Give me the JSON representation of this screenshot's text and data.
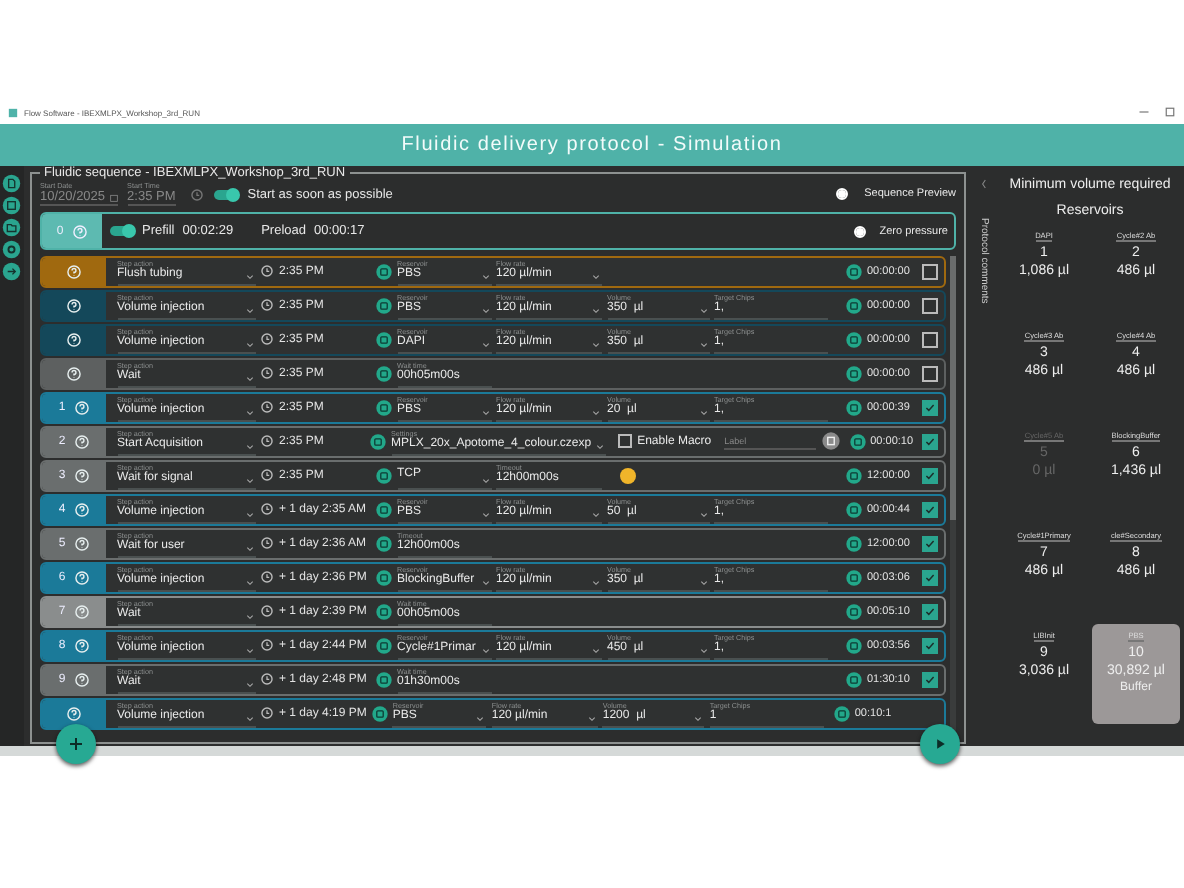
{
  "window": {
    "title": "Flow Software - IBEXMLPX_Workshop_3rd_RUN"
  },
  "header": {
    "title": "Fluidic delivery protocol - Simulation"
  },
  "sequence": {
    "title": "Fluidic sequence - IBEXMLPX_Workshop_3rd_RUN",
    "start_date": {
      "label": "Start Date",
      "value": "10/20/2025"
    },
    "start_time": {
      "label": "Start Time",
      "value": "2:35 PM"
    },
    "asap": {
      "label": "Start as soon as possible",
      "on": true
    },
    "preview": {
      "label": "Sequence Preview",
      "selected": true
    },
    "prefill": {
      "number": "0",
      "toggle_on": true,
      "prefill_label": "Prefill",
      "prefill_time": "00:02:29",
      "preload_label": "Preload",
      "preload_time": "00:00:17",
      "zero": {
        "label": "Zero pressure",
        "selected": true
      }
    },
    "steps": [
      {
        "color": "#a0690f",
        "action_label": "Step action",
        "action": "Flush tubing",
        "time": "2:35 PM",
        "fields": [
          {
            "label": "Reservoir",
            "value": "PBS",
            "dropdown": true
          },
          {
            "label": "Flow rate",
            "value": "120 µl/min",
            "dropdown": true
          }
        ],
        "duration": "00:00:00",
        "checked": false
      },
      {
        "color": "#14485a",
        "action_label": "Step action",
        "action": "Volume injection",
        "time": "2:35 PM",
        "fields": [
          {
            "label": "Reservoir",
            "value": "PBS",
            "dropdown": true
          },
          {
            "label": "Flow rate",
            "value": "120 µl/min",
            "dropdown": true
          },
          {
            "label": "Volume",
            "value": "350",
            "unit": "µl",
            "dropdown": true
          },
          {
            "label": "Target Chips",
            "value": "1,",
            "dropdown": false
          }
        ],
        "duration": "00:00:00",
        "checked": false
      },
      {
        "color": "#14485a",
        "action_label": "Step action",
        "action": "Volume injection",
        "time": "2:35 PM",
        "fields": [
          {
            "label": "Reservoir",
            "value": "DAPI",
            "dropdown": true
          },
          {
            "label": "Flow rate",
            "value": "120 µl/min",
            "dropdown": true
          },
          {
            "label": "Volume",
            "value": "350",
            "unit": "µl",
            "dropdown": true
          },
          {
            "label": "Target Chips",
            "value": "1,",
            "dropdown": false
          }
        ],
        "duration": "00:00:00",
        "checked": false
      },
      {
        "color": "#5d6060",
        "action_label": "Step action",
        "action": "Wait",
        "time": "2:35 PM",
        "fields": [
          {
            "label": "Wait time",
            "value": "00h05m00s",
            "dropdown": false
          }
        ],
        "duration": "00:00:00",
        "checked": false
      },
      {
        "number": "1",
        "color": "#1b7a99",
        "action_label": "Step action",
        "action": "Volume injection",
        "time": "2:35 PM",
        "fields": [
          {
            "label": "Reservoir",
            "value": "PBS",
            "dropdown": true
          },
          {
            "label": "Flow rate",
            "value": "120 µl/min",
            "dropdown": true
          },
          {
            "label": "Volume",
            "value": "20",
            "unit": "µl",
            "dropdown": true
          },
          {
            "label": "Target Chips",
            "value": "1,",
            "dropdown": false
          }
        ],
        "duration": "00:00:39",
        "checked": true
      },
      {
        "number": "2",
        "color": "#6a6e6e",
        "action_label": "Step action",
        "action": "Start Acquisition",
        "time": "2:35 PM",
        "fields": [
          {
            "label": "Settings",
            "value": "MPLX_20x_Apotome_4_colour.czexp",
            "dropdown": true
          }
        ],
        "macro": {
          "label": "Enable Macro",
          "checked": false
        },
        "label_field": {
          "placeholder": "Label"
        },
        "duration": "00:00:10",
        "checked": true
      },
      {
        "number": "3",
        "color": "#6a6e6e",
        "action_label": "Step action",
        "action": "Wait for signal",
        "time": "2:35 PM",
        "fields": [
          {
            "value": "TCP",
            "dropdown": true
          },
          {
            "label": "Timeout",
            "value": "12h00m00s",
            "dropdown": false
          }
        ],
        "alert": true,
        "duration": "12:00:00",
        "checked": true
      },
      {
        "number": "4",
        "color": "#1b7a99",
        "action_label": "Step action",
        "action": "Volume injection",
        "time": "+ 1 day 2:35 AM",
        "fields": [
          {
            "label": "Reservoir",
            "value": "PBS",
            "dropdown": true
          },
          {
            "label": "Flow rate",
            "value": "120 µl/min",
            "dropdown": true
          },
          {
            "label": "Volume",
            "value": "50",
            "unit": "µl",
            "dropdown": true
          },
          {
            "label": "Target Chips",
            "value": "1,",
            "dropdown": false
          }
        ],
        "duration": "00:00:44",
        "checked": true
      },
      {
        "number": "5",
        "color": "#6a6e6e",
        "action_label": "Step action",
        "action": "Wait for user",
        "time": "+ 1 day 2:36 AM",
        "fields": [
          {
            "label": "Timeout",
            "value": "12h00m00s",
            "dropdown": false
          }
        ],
        "duration": "12:00:00",
        "checked": true
      },
      {
        "number": "6",
        "color": "#1b7a99",
        "action_label": "Step action",
        "action": "Volume injection",
        "time": "+ 1 day 2:36 PM",
        "fields": [
          {
            "label": "Reservoir",
            "value": "BlockingBuffer",
            "dropdown": true
          },
          {
            "label": "Flow rate",
            "value": "120 µl/min",
            "dropdown": true
          },
          {
            "label": "Volume",
            "value": "350",
            "unit": "µl",
            "dropdown": true
          },
          {
            "label": "Target Chips",
            "value": "1,",
            "dropdown": false
          }
        ],
        "duration": "00:03:06",
        "checked": true
      },
      {
        "number": "7",
        "color": "#8a8d8d",
        "action_label": "Step action",
        "action": "Wait",
        "time": "+ 1 day 2:39 PM",
        "fields": [
          {
            "label": "Wait time",
            "value": "00h05m00s",
            "dropdown": false
          }
        ],
        "duration": "00:05:10",
        "checked": true
      },
      {
        "number": "8",
        "color": "#1b7a99",
        "action_label": "Step action",
        "action": "Volume injection",
        "time": "+ 1 day 2:44 PM",
        "fields": [
          {
            "label": "Reservoir",
            "value": "Cycle#1Primar",
            "dropdown": true
          },
          {
            "label": "Flow rate",
            "value": "120 µl/min",
            "dropdown": true
          },
          {
            "label": "Volume",
            "value": "450",
            "unit": "µl",
            "dropdown": true
          },
          {
            "label": "Target Chips",
            "value": "1,",
            "dropdown": false
          }
        ],
        "duration": "00:03:56",
        "checked": true
      },
      {
        "number": "9",
        "color": "#6a6e6e",
        "action_label": "Step action",
        "action": "Wait",
        "time": "+ 1 day 2:48 PM",
        "fields": [
          {
            "label": "Wait time",
            "value": "01h30m00s",
            "dropdown": false
          }
        ],
        "duration": "01:30:10",
        "checked": true
      },
      {
        "color": "#1b7a99",
        "action_label": "Step action",
        "action": "Volume injection",
        "time": "+ 1 day 4:19 PM",
        "fields": [
          {
            "label": "Reservoir",
            "value": "PBS",
            "dropdown": true
          },
          {
            "label": "Flow rate",
            "value": "120 µl/min",
            "dropdown": true
          },
          {
            "label": "Volume",
            "value": "1200",
            "unit": "µl",
            "dropdown": true
          },
          {
            "label": "Target Chips",
            "value": "1",
            "dropdown": false
          }
        ],
        "duration": "00:10:1"
      }
    ]
  },
  "comments_tab": {
    "label": "Protocol comments"
  },
  "reservoirs": {
    "title": "Minimum volume required",
    "subtitle": "Reservoirs",
    "items": [
      {
        "name": "DAPI",
        "number": "1",
        "volume": "1,086 µl",
        "disabled": false,
        "selected": false
      },
      {
        "name": "Cycle#2 Ab",
        "number": "2",
        "volume": "486 µl",
        "disabled": false,
        "selected": false
      },
      {
        "name": "Cycle#3 Ab",
        "number": "3",
        "volume": "486 µl",
        "disabled": false,
        "selected": false
      },
      {
        "name": "Cycle#4 Ab",
        "number": "4",
        "volume": "486 µl",
        "disabled": false,
        "selected": false
      },
      {
        "name": "Cycle#5 Ab",
        "number": "5",
        "volume": "0 µl",
        "disabled": true,
        "selected": false
      },
      {
        "name": "BlockingBuffer",
        "number": "6",
        "volume": "1,436 µl",
        "disabled": false,
        "selected": false
      },
      {
        "name": "Cycle#1Primary",
        "number": "7",
        "volume": "486 µl",
        "disabled": false,
        "selected": false
      },
      {
        "name": "cle#Secondary",
        "number": "8",
        "volume": "486 µl",
        "disabled": false,
        "selected": false
      },
      {
        "name": "LIBInit",
        "number": "9",
        "volume": "3,036 µl",
        "disabled": false,
        "selected": false
      },
      {
        "name": "PBS",
        "number": "10",
        "volume": "30,892 µl",
        "tag": "Buffer",
        "disabled": false,
        "selected": true
      }
    ]
  }
}
